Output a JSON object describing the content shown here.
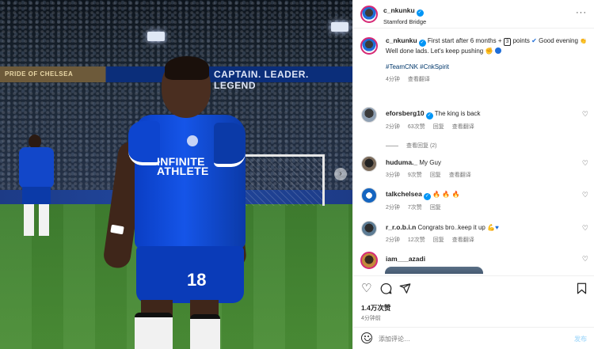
{
  "photo": {
    "stand_banner": "CAPTAIN. LEADER. LEGEND",
    "stand_banner_left": "PRIDE OF CHELSEA",
    "shirt_sponsor_line1": "INFINITE",
    "shirt_sponsor_line2": "ATHLETE",
    "shirt_number": "18",
    "next_icon": "chevron-right-icon"
  },
  "header": {
    "username": "c_nkunku",
    "location": "Stamford Bridge",
    "more_icon": "more-horizontal-icon"
  },
  "caption": {
    "username": "c_nkunku",
    "text_line1": "First start after 6 months + ",
    "points_badge": "3",
    "text_line1_end": " points ",
    "text_line2": "Good evening ",
    "text_line3": "Well done lads. Let's keep pushing ",
    "hashtags": "#TeamCNK #CnkSpirit",
    "time": "4分钟",
    "translate": "查看翻译"
  },
  "comments": [
    {
      "username": "eforsberg10",
      "verified": true,
      "text": "The king is back",
      "time": "2分钟",
      "likes": "63次赞",
      "reply": "回复",
      "translate": "查看翻译",
      "view_replies": "查看回复 (2)"
    },
    {
      "username": "huduma._",
      "verified": false,
      "text": "My Guy",
      "time": "3分钟",
      "likes": "9次赞",
      "reply": "回复",
      "translate": "查看翻译"
    },
    {
      "username": "talkchelsea",
      "verified": true,
      "text": "",
      "time": "2分钟",
      "likes": "7次赞",
      "reply": "回复"
    },
    {
      "username": "r_r.o.b.i.n",
      "verified": false,
      "text": "Congrats bro..keep it up",
      "time": "2分钟",
      "likes": "12次赞",
      "reply": "回复",
      "translate": "查看翻译"
    },
    {
      "username": "iam___azadi",
      "verified": false,
      "text": ""
    }
  ],
  "actions": {
    "like_icon": "heart-icon",
    "comment_icon": "comment-icon",
    "share_icon": "send-icon",
    "save_icon": "bookmark-icon",
    "likes_count": "1.4万次赞",
    "posted_ago": "4分钟前"
  },
  "compose": {
    "emoji_icon": "emoji-icon",
    "placeholder": "添加评论…",
    "post_label": "发布"
  }
}
